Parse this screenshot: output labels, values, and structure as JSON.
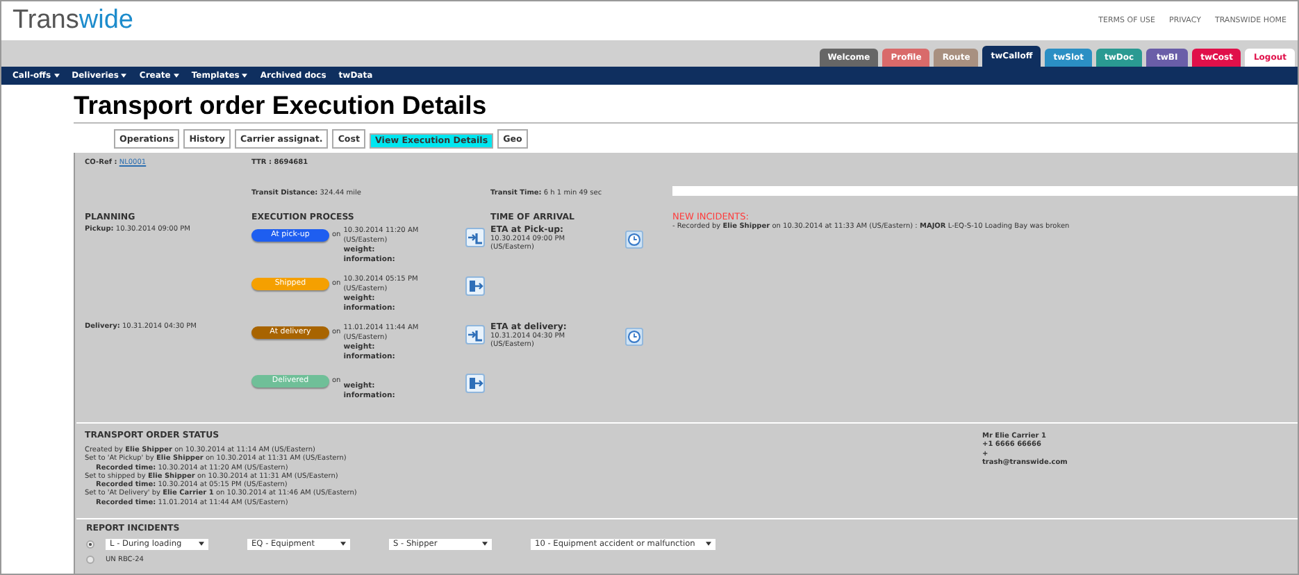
{
  "header": {
    "logo": [
      "Trans",
      "wide"
    ],
    "links": [
      "TERMS OF USE",
      "PRIVACY",
      "TRANSWIDE HOME"
    ]
  },
  "app_tabs": [
    {
      "label": "Welcome",
      "color": "#666666",
      "selected": false
    },
    {
      "label": "Profile",
      "color": "#d96a6a",
      "selected": false
    },
    {
      "label": "Route",
      "color": "#a89080",
      "selected": false
    },
    {
      "label": "twCalloff",
      "color": "#0f2f5f",
      "selected": true
    },
    {
      "label": "twSlot",
      "color": "#2b8fc4",
      "selected": false
    },
    {
      "label": "twDoc",
      "color": "#2a9a92",
      "selected": false
    },
    {
      "label": "twBI",
      "color": "#6a5ea8",
      "selected": false
    },
    {
      "label": "twCost",
      "color": "#e0104a",
      "selected": false
    },
    {
      "label": "Logout",
      "color": "#ffffff",
      "selected": false
    }
  ],
  "menu": [
    {
      "label": "Call-offs",
      "dropdown": true
    },
    {
      "label": "Deliveries",
      "dropdown": true
    },
    {
      "label": "Create",
      "dropdown": true
    },
    {
      "label": "Templates",
      "dropdown": true
    },
    {
      "label": "Archived docs",
      "dropdown": false
    },
    {
      "label": "twData",
      "dropdown": false
    }
  ],
  "title": "Transport order Execution Details",
  "tabs": [
    {
      "label": "Operations",
      "selected": false
    },
    {
      "label": "History",
      "selected": false
    },
    {
      "label": "Carrier assignat.",
      "selected": false
    },
    {
      "label": "Cost",
      "selected": false
    },
    {
      "label": "View Execution Details",
      "selected": true
    },
    {
      "label": "Geo",
      "selected": false
    }
  ],
  "summary": {
    "co_ref_label": "CO-Ref :",
    "co_ref": "NL0001",
    "ttr": "TTR : 8694681",
    "distance_label": "Transit Distance:",
    "distance": "324.44 mile",
    "time_label": "Transit Time:",
    "time": "6 h 1 min 49 sec"
  },
  "headings": {
    "planning": "PLANNING",
    "execution": "EXECUTION PROCESS",
    "arrival": "TIME OF ARRIVAL"
  },
  "steps": [
    {
      "status": "At pick-up",
      "color": "#1e5ef0",
      "on": "on",
      "date": "10.30.2014 11:20 AM",
      "tz": "(US/Eastern)",
      "weight": "weight:",
      "info": "information:",
      "kind": "in",
      "planning": {
        "label": "Pickup:",
        "value": "10.30.2014 09:00 PM"
      },
      "eta": {
        "label": "ETA at Pick-up:",
        "date": "10.30.2014 09:00 PM",
        "tz": "(US/Eastern)"
      }
    },
    {
      "status": "Shipped",
      "color": "#f5a000",
      "on": "on",
      "date": "10.30.2014 05:15 PM",
      "tz": "(US/Eastern)",
      "weight": "weight:",
      "info": "information:",
      "kind": "out"
    },
    {
      "status": "At delivery",
      "color": "#a86400",
      "on": "on",
      "date": "11.01.2014 11:44 AM",
      "tz": "(US/Eastern)",
      "weight": "weight:",
      "info": "information:",
      "kind": "in",
      "planning": {
        "label": "Delivery:",
        "value": "10.31.2014 04:30 PM"
      },
      "eta": {
        "label": "ETA at delivery:",
        "date": "10.31.2014 04:30 PM",
        "tz": "(US/Eastern)"
      }
    },
    {
      "status": "Delivered",
      "color": "#6fbf98",
      "on": "on",
      "weight": "weight:",
      "info": "information:",
      "kind": "out"
    }
  ],
  "incidents": {
    "heading": "NEW INCIDENTS:",
    "items": [
      "- Recorded by **Elie Shipper** on 10.30.2014 at 11:33 AM (US/Eastern) : **MAJOR**  L-EQ-S-10  Loading Bay was broken"
    ]
  },
  "status": {
    "heading": "TRANSPORT ORDER STATUS",
    "lines": [
      {
        "text": "Created by  **Elie Shipper** on 10.30.2014 at 11:14 AM (US/Eastern)",
        "indented": false
      },
      {
        "text": "Set to 'At Pickup' by  **Elie Shipper** on 10.30.2014 at 11:31 AM (US/Eastern)",
        "indented": false
      },
      {
        "text": "**Recorded time:** 10.30.2014  at 11:20 AM (US/Eastern)",
        "indented": true
      },
      {
        "text": "Set to shipped by  **Elie Shipper** on 10.30.2014 at 11:31 AM (US/Eastern)",
        "indented": false
      },
      {
        "text": "**Recorded time:** 10.30.2014  at 05:15 PM (US/Eastern)",
        "indented": true
      },
      {
        "text": "Set to 'At Delivery' by  **Elie Carrier 1** on 10.30.2014 at 11:46 AM (US/Eastern)",
        "indented": false
      },
      {
        "text": "**Recorded time:** 11.01.2014  at 11:44 AM (US/Eastern)",
        "indented": true
      }
    ],
    "contact": [
      "Mr Elie  Carrier 1",
      "+1 6666 66666",
      "+",
      "trash@transwide.com"
    ]
  },
  "report": {
    "heading": "REPORT INCIDENTS",
    "rows": [
      {
        "checked": true,
        "selects": [
          "L - During loading",
          "EQ - Equipment",
          "S - Shipper",
          "10 - Equipment accident or malfunction"
        ]
      },
      {
        "checked": false,
        "note": "UN RBC-24"
      }
    ]
  }
}
